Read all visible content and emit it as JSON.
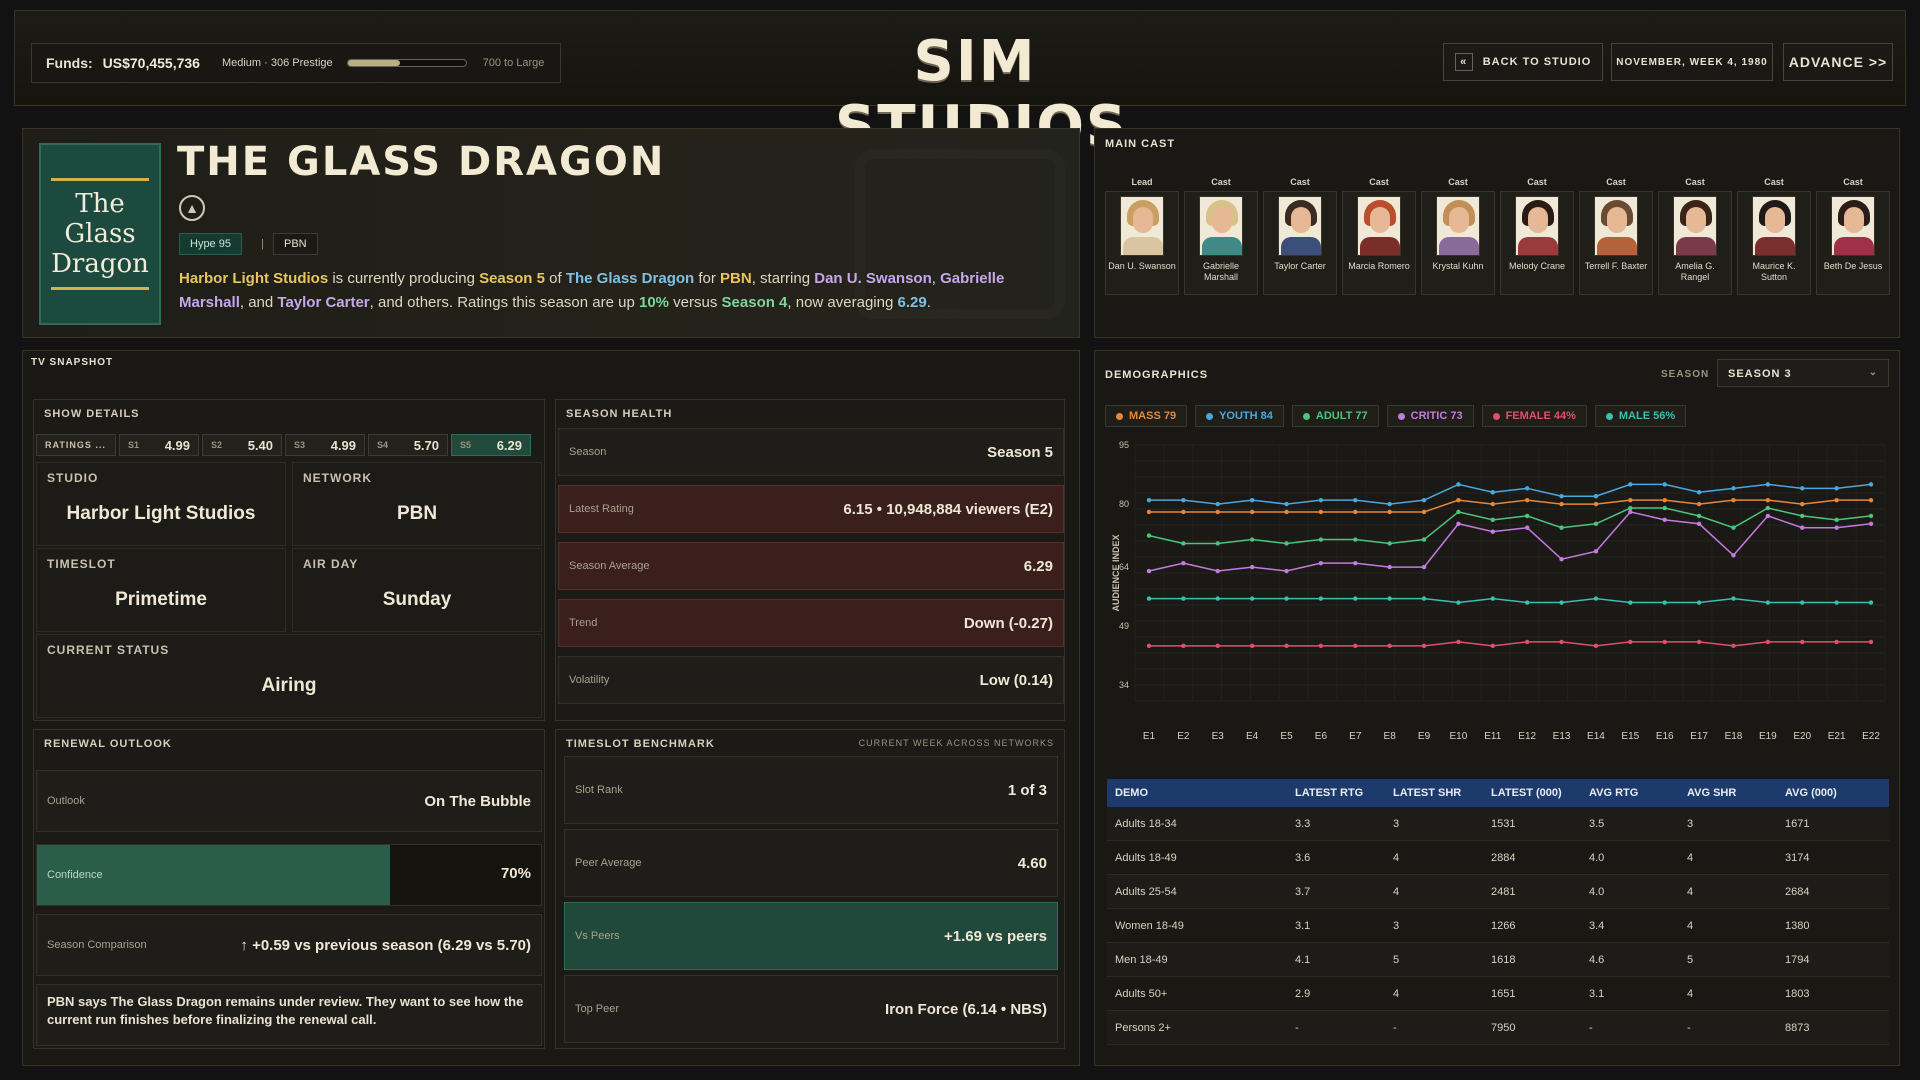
{
  "header": {
    "funds_label": "Funds:",
    "funds_value": "US$70,455,736",
    "tier": "Medium · 306 Prestige",
    "prestige_progress": 0.44,
    "next_tier": "700 to Large",
    "logo": "SIM STUDIOS",
    "back_label": "BACK TO STUDIO",
    "back_icon": "«",
    "date": "NOVEMBER, WEEK 4, 1980",
    "advance_label": "ADVANCE >>"
  },
  "show": {
    "poster_text": [
      "The",
      "Glass",
      "Dragon"
    ],
    "title": "THE GLASS DRAGON",
    "network_icon": "network-logo-icon",
    "hype": "Hype 95",
    "separator": "|",
    "network": "PBN",
    "desc": [
      {
        "t": "Harbor Light Studios",
        "c": "y"
      },
      {
        "t": " is currently producing ",
        "c": ""
      },
      {
        "t": "Season 5",
        "c": "y"
      },
      {
        "t": " of ",
        "c": ""
      },
      {
        "t": "The Glass Dragon",
        "c": "b"
      },
      {
        "t": " for ",
        "c": ""
      },
      {
        "t": "PBN",
        "c": "y"
      },
      {
        "t": ", starring ",
        "c": ""
      },
      {
        "t": "Dan U. Swanson",
        "c": "p"
      },
      {
        "t": ", ",
        "c": ""
      },
      {
        "t": "Gabrielle Marshall",
        "c": "p"
      },
      {
        "t": ", and ",
        "c": ""
      },
      {
        "t": "Taylor Carter",
        "c": "p"
      },
      {
        "t": ", and others. Ratings this season are up ",
        "c": ""
      },
      {
        "t": "10%",
        "c": "g"
      },
      {
        "t": " versus ",
        "c": ""
      },
      {
        "t": "Season 4",
        "c": "g"
      },
      {
        "t": ", now averaging ",
        "c": ""
      },
      {
        "t": "6.29",
        "c": "b"
      },
      {
        "t": ".",
        "c": ""
      }
    ]
  },
  "cast": {
    "title": "MAIN CAST",
    "members": [
      {
        "role": "Lead",
        "name": "Dan U. Swanson",
        "hair": "#c9a062",
        "shirt": "#d9c6a0"
      },
      {
        "role": "Cast",
        "name": "Gabrielle Marshall",
        "hair": "#d8c28a",
        "shirt": "#3f8a86"
      },
      {
        "role": "Cast",
        "name": "Taylor Carter",
        "hair": "#3a2a20",
        "shirt": "#3b4f7a"
      },
      {
        "role": "Cast",
        "name": "Marcia Romero",
        "hair": "#b8502e",
        "shirt": "#7a2e2a"
      },
      {
        "role": "Cast",
        "name": "Krystal Kuhn",
        "hair": "#c09058",
        "shirt": "#8a6a9a"
      },
      {
        "role": "Cast",
        "name": "Melody Crane",
        "hair": "#2a1a14",
        "shirt": "#9a3a3a"
      },
      {
        "role": "Cast",
        "name": "Terrell F. Baxter",
        "hair": "#6a4a30",
        "shirt": "#b5623a"
      },
      {
        "role": "Cast",
        "name": "Amelia G. Rangel",
        "hair": "#3a2418",
        "shirt": "#7a3a4a"
      },
      {
        "role": "Cast",
        "name": "Maurice K. Sutton",
        "hair": "#1e1a18",
        "shirt": "#7a2e2e"
      },
      {
        "role": "Cast",
        "name": "Beth De Jesus",
        "hair": "#2a1c16",
        "shirt": "#a03048"
      }
    ]
  },
  "snapshot": {
    "title": "TV SNAPSHOT",
    "details": {
      "title": "SHOW DETAILS",
      "ratings_label": "RATINGS ...",
      "ratings": [
        {
          "s": "S1",
          "v": "4.99"
        },
        {
          "s": "S2",
          "v": "5.40"
        },
        {
          "s": "S3",
          "v": "4.99"
        },
        {
          "s": "S4",
          "v": "5.70"
        },
        {
          "s": "S5",
          "v": "6.29"
        }
      ],
      "studio_label": "STUDIO",
      "studio": "Harbor Light Studios",
      "network_label": "NETWORK",
      "network": "PBN",
      "timeslot_label": "TIMESLOT",
      "timeslot": "Primetime",
      "airday_label": "AIR DAY",
      "airday": "Sunday",
      "status_label": "CURRENT STATUS",
      "status": "Airing"
    },
    "health": {
      "title": "SEASON HEALTH",
      "rows": [
        {
          "k": "Season",
          "v": "Season 5",
          "red": false
        },
        {
          "k": "Latest Rating",
          "v": "6.15 • 10,948,884 viewers (E2)",
          "red": true
        },
        {
          "k": "Season Average",
          "v": "6.29",
          "red": true
        },
        {
          "k": "Trend",
          "v": "Down (-0.27)",
          "red": true
        },
        {
          "k": "Volatility",
          "v": "Low (0.14)",
          "red": false
        }
      ]
    },
    "renewal": {
      "title": "RENEWAL OUTLOOK",
      "outlook_label": "Outlook",
      "outlook": "On The Bubble",
      "confidence_label": "Confidence",
      "confidence": "70%",
      "confidence_value": 0.7,
      "comparison_label": "Season Comparison",
      "comparison": "↑  +0.59 vs previous season (6.29 vs 5.70)",
      "note": "PBN says The Glass Dragon remains under review. They want to see how the current run finishes before finalizing the renewal call."
    },
    "benchmark": {
      "title": "TIMESLOT BENCHMARK",
      "subtitle": "CURRENT WEEK ACROSS NETWORKS",
      "rows": [
        {
          "k": "Slot Rank",
          "v": "1 of 3",
          "green": false
        },
        {
          "k": "Peer Average",
          "v": "4.60",
          "green": false
        },
        {
          "k": "Vs Peers",
          "v": "+1.69 vs peers",
          "green": true
        },
        {
          "k": "Top Peer",
          "v": "Iron Force (6.14 • NBS)",
          "green": false
        }
      ]
    }
  },
  "demographics": {
    "title": "DEMOGRAPHICS",
    "season_label": "SEASON",
    "season_value": "SEASON 3",
    "legend": [
      {
        "label": "MASS 79",
        "color": "#e8873a"
      },
      {
        "label": "YOUTH 84",
        "color": "#4aa8e0"
      },
      {
        "label": "ADULT 77",
        "color": "#4cc47a"
      },
      {
        "label": "CRITIC 73",
        "color": "#c47adf"
      },
      {
        "label": "FEMALE 44%",
        "color": "#e0506a"
      },
      {
        "label": "MALE 56%",
        "color": "#38c0b0"
      }
    ],
    "table": {
      "headers": [
        "DEMO",
        "LATEST RTG",
        "LATEST SHR",
        "LATEST (000)",
        "AVG RTG",
        "AVG SHR",
        "AVG (000)"
      ],
      "rows": [
        [
          "Adults 18-34",
          "3.3",
          "3",
          "1531",
          "3.5",
          "3",
          "1671"
        ],
        [
          "Adults 18-49",
          "3.6",
          "4",
          "2884",
          "4.0",
          "4",
          "3174"
        ],
        [
          "Adults 25-54",
          "3.7",
          "4",
          "2481",
          "4.0",
          "4",
          "2684"
        ],
        [
          "Women 18-49",
          "3.1",
          "3",
          "1266",
          "3.4",
          "4",
          "1380"
        ],
        [
          "Men 18-49",
          "4.1",
          "5",
          "1618",
          "4.6",
          "5",
          "1794"
        ],
        [
          "Adults 50+",
          "2.9",
          "4",
          "1651",
          "3.1",
          "4",
          "1803"
        ],
        [
          "Persons 2+",
          "-",
          "-",
          "7950",
          "-",
          "-",
          "8873"
        ]
      ]
    }
  },
  "chart_data": {
    "type": "line",
    "ylabel": "AUDIENCE INDEX",
    "ylim": [
      30,
      95
    ],
    "yticks": [
      95,
      80,
      64,
      49,
      34
    ],
    "categories": [
      "E1",
      "E2",
      "E3",
      "E4",
      "E5",
      "E6",
      "E7",
      "E8",
      "E9",
      "E10",
      "E11",
      "E12",
      "E13",
      "E14",
      "E15",
      "E16",
      "E17",
      "E18",
      "E19",
      "E20",
      "E21",
      "E22"
    ],
    "grid": true,
    "series": [
      {
        "name": "YOUTH",
        "color": "#4aa8e0",
        "values": [
          81,
          81,
          80,
          81,
          80,
          81,
          81,
          80,
          81,
          85,
          83,
          84,
          82,
          82,
          85,
          85,
          83,
          84,
          85,
          84,
          84,
          85
        ]
      },
      {
        "name": "MASS",
        "color": "#e8873a",
        "values": [
          78,
          78,
          78,
          78,
          78,
          78,
          78,
          78,
          78,
          81,
          80,
          81,
          80,
          80,
          81,
          81,
          80,
          81,
          81,
          80,
          81,
          81
        ]
      },
      {
        "name": "ADULT",
        "color": "#4cc47a",
        "values": [
          72,
          70,
          70,
          71,
          70,
          71,
          71,
          70,
          71,
          78,
          76,
          77,
          74,
          75,
          79,
          79,
          77,
          74,
          79,
          77,
          76,
          77
        ]
      },
      {
        "name": "CRITIC",
        "color": "#c47adf",
        "values": [
          63,
          65,
          63,
          64,
          63,
          65,
          65,
          64,
          64,
          75,
          73,
          74,
          66,
          68,
          78,
          76,
          75,
          67,
          77,
          74,
          74,
          75
        ]
      },
      {
        "name": "MALE",
        "color": "#38c0b0",
        "values": [
          56,
          56,
          56,
          56,
          56,
          56,
          56,
          56,
          56,
          55,
          56,
          55,
          55,
          56,
          55,
          55,
          55,
          56,
          55,
          55,
          55,
          55
        ]
      },
      {
        "name": "FEMALE",
        "color": "#e0506a",
        "values": [
          44,
          44,
          44,
          44,
          44,
          44,
          44,
          44,
          44,
          45,
          44,
          45,
          45,
          44,
          45,
          45,
          45,
          44,
          45,
          45,
          45,
          45
        ]
      }
    ]
  }
}
